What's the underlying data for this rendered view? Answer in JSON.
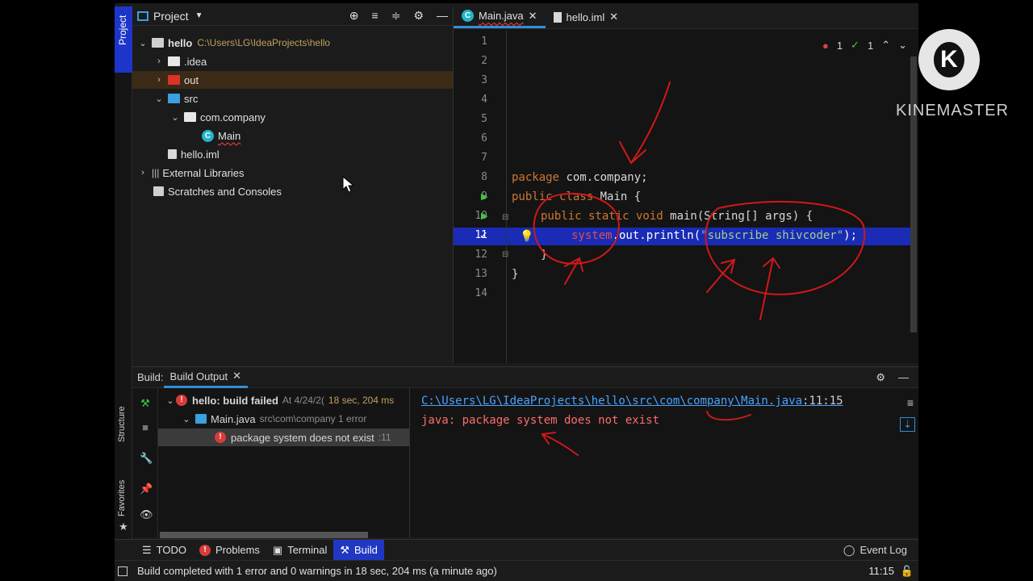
{
  "project_panel": {
    "title": "Project",
    "tree": [
      {
        "label": "hello",
        "path": "C:\\Users\\LG\\IdeaProjects\\hello"
      },
      {
        "label": ".idea"
      },
      {
        "label": "out"
      },
      {
        "label": "src"
      },
      {
        "label": "com.company"
      },
      {
        "label": "Main"
      },
      {
        "label": "hello.iml"
      },
      {
        "label": "External Libraries"
      },
      {
        "label": "Scratches and Consoles"
      }
    ]
  },
  "left_strip": {
    "project_tab": "Project",
    "structure_tab": "Structure",
    "favorites_tab": "Favorites"
  },
  "editor": {
    "tabs": [
      {
        "label": "Main.java"
      },
      {
        "label": "hello.iml"
      }
    ],
    "status": {
      "errors": "1",
      "checks": "1"
    },
    "line_numbers": [
      "1",
      "2",
      "3",
      "4",
      "5",
      "6",
      "7",
      "8",
      "9",
      "10",
      "11",
      "12",
      "13",
      "14"
    ],
    "code": {
      "l8_kw": "package",
      "l8_rest": " com.company;",
      "l9_kw": "public class",
      "l9_rest": " Main {",
      "l10_kw": "public static void",
      "l10_rest": " main(String[] args) {",
      "l11_err": "system",
      "l11_mid": ".out.println(",
      "l11_str": "\"subscribe shivcoder\"",
      "l11_end": ");",
      "l12": "}",
      "l13": "}"
    }
  },
  "build": {
    "label": "Build:",
    "tab": "Build Output",
    "tree": {
      "root_label": "hello: build failed",
      "root_meta": "At 4/24/2(",
      "root_time": "18 sec, 204 ms",
      "file_label": "Main.java",
      "file_meta": "src\\com\\company 1 error",
      "error_label": "package system does not exist",
      "error_meta": ":11"
    },
    "output": {
      "link": "C:\\Users\\LG\\IdeaProjects\\hello\\src\\com\\company\\Main.java",
      "position": ":11:15",
      "error": "java: package system does not exist"
    }
  },
  "tool_windows": [
    {
      "label": "TODO"
    },
    {
      "label": "Problems"
    },
    {
      "label": "Terminal"
    },
    {
      "label": "Build"
    }
  ],
  "event_log": "Event Log",
  "status_bar": {
    "message": "Build completed with 1 error and 0 warnings in 18 sec, 204 ms (a minute ago)",
    "time": "11:15"
  },
  "watermark": {
    "text": "KINEMASTER",
    "logo_letter": "K"
  },
  "colors": {
    "accent": "#2037c4",
    "error": "#d93a3a",
    "keyword": "#cc7832",
    "string": "#6a8759"
  }
}
